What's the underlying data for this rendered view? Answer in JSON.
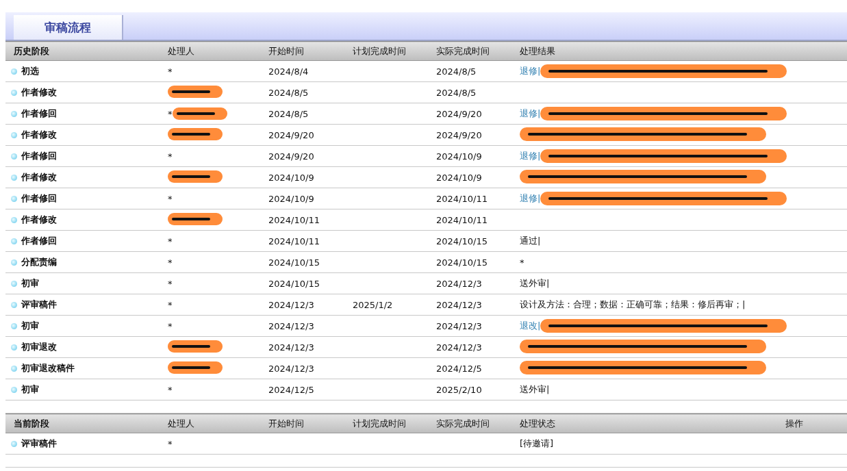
{
  "tabs": [
    {
      "label": "审稿流程",
      "selected": true
    }
  ],
  "history": {
    "columns": [
      "历史阶段",
      "处理人",
      "开始时间",
      "计划完成时间",
      "实际完成时间",
      "处理结果"
    ],
    "rows": [
      {
        "stage": "初选",
        "handler": {
          "text": "*",
          "redacted": false
        },
        "start": "2024/8/4",
        "actual": "2024/8/5",
        "result": {
          "text": "退修|",
          "link": true,
          "redacted": true
        }
      },
      {
        "stage": "作者修改",
        "handler": {
          "redacted": true
        },
        "start": "2024/8/5",
        "actual": "2024/8/5",
        "result": {
          "redacted": false
        }
      },
      {
        "stage": "作者修回",
        "handler": {
          "text": "*",
          "redacted": true
        },
        "start": "2024/8/5",
        "actual": "2024/9/20",
        "result": {
          "text": "退修|",
          "link": true,
          "redacted": true
        }
      },
      {
        "stage": "作者修改",
        "handler": {
          "redacted": true
        },
        "start": "2024/9/20",
        "actual": "2024/9/20",
        "result": {
          "redacted": true
        }
      },
      {
        "stage": "作者修回",
        "handler": {
          "text": "*",
          "redacted": false
        },
        "start": "2024/9/20",
        "actual": "2024/10/9",
        "result": {
          "text": "退修|",
          "link": true,
          "redacted": true
        }
      },
      {
        "stage": "作者修改",
        "handler": {
          "redacted": true
        },
        "start": "2024/10/9",
        "actual": "2024/10/9",
        "result": {
          "redacted": true
        }
      },
      {
        "stage": "作者修回",
        "handler": {
          "text": "*",
          "redacted": false
        },
        "start": "2024/10/9",
        "actual": "2024/10/11",
        "result": {
          "text": "退修|",
          "link": true,
          "redacted": true
        }
      },
      {
        "stage": "作者修改",
        "handler": {
          "redacted": true
        },
        "start": "2024/10/11",
        "actual": "2024/10/11",
        "result": {
          "redacted": false
        }
      },
      {
        "stage": "作者修回",
        "handler": {
          "text": "*",
          "redacted": false
        },
        "start": "2024/10/11",
        "actual": "2024/10/15",
        "result": {
          "text": "通过|",
          "link": false,
          "redacted": false
        }
      },
      {
        "stage": "分配责编",
        "handler": {
          "text": "*",
          "redacted": false
        },
        "start": "2024/10/15",
        "actual": "2024/10/15",
        "result": {
          "text": "*",
          "link": false,
          "redacted": false
        }
      },
      {
        "stage": "初审",
        "handler": {
          "text": "*",
          "redacted": false
        },
        "start": "2024/10/15",
        "actual": "2024/12/3",
        "result": {
          "text": "送外审|",
          "link": false,
          "redacted": false
        }
      },
      {
        "stage": "评审稿件",
        "handler": {
          "text": "*",
          "redacted": false
        },
        "start": "2024/12/3",
        "planned": "2025/1/2",
        "actual": "2024/12/3",
        "result": {
          "text": "设计及方法：合理；数据：正确可靠；结果：修后再审；|",
          "link": false,
          "redacted": false
        }
      },
      {
        "stage": "初审",
        "handler": {
          "text": "*",
          "redacted": false
        },
        "start": "2024/12/3",
        "actual": "2024/12/3",
        "result": {
          "text": "退改|",
          "link": true,
          "redacted": true
        }
      },
      {
        "stage": "初审退改",
        "handler": {
          "redacted": true
        },
        "start": "2024/12/3",
        "actual": "2024/12/3",
        "result": {
          "redacted": true
        }
      },
      {
        "stage": "初审退改稿件",
        "handler": {
          "redacted": true
        },
        "start": "2024/12/3",
        "actual": "2024/12/5",
        "result": {
          "redacted": true
        }
      },
      {
        "stage": "初审",
        "handler": {
          "text": "*",
          "redacted": false
        },
        "start": "2024/12/5",
        "actual": "2025/2/10",
        "result": {
          "text": "送外审|",
          "link": false,
          "redacted": false
        }
      }
    ]
  },
  "current": {
    "columns": [
      "当前阶段",
      "处理人",
      "开始时间",
      "计划完成时间",
      "实际完成时间",
      "处理状态",
      "操作"
    ],
    "rows": [
      {
        "stage": "评审稿件",
        "handler": "*",
        "status": "[待邀请]"
      }
    ]
  }
}
